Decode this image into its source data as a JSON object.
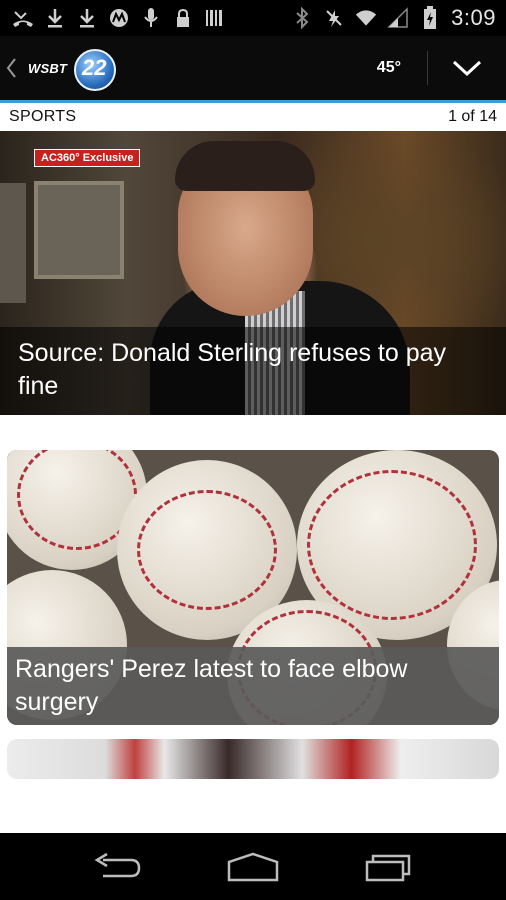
{
  "status_bar": {
    "time": "3:09",
    "left_icons": [
      "missed-call-icon",
      "download-icon",
      "download-icon",
      "motorola-icon",
      "microphone-icon",
      "lock-icon",
      "barcode-icon"
    ],
    "right_icons": [
      "bluetooth-icon",
      "vibrate-off-icon",
      "wifi-icon",
      "signal-icon",
      "battery-charging-icon"
    ]
  },
  "header": {
    "logo_text": "WSBT",
    "logo_channel": "22",
    "temperature": "45°"
  },
  "section": {
    "title": "SPORTS",
    "page_count": "1 of 14"
  },
  "stories": [
    {
      "tag": "AC360° Exclusive",
      "headline": "Source: Donald Sterling refuses to pay fine"
    },
    {
      "headline": "Rangers' Perez latest to face elbow surgery"
    },
    {
      "headline": ""
    }
  ],
  "nav": {
    "icons": [
      "back-icon",
      "home-icon",
      "recent-apps-icon"
    ]
  },
  "colors": {
    "accent": "#33a0d8",
    "tag_red": "#c7211d"
  }
}
